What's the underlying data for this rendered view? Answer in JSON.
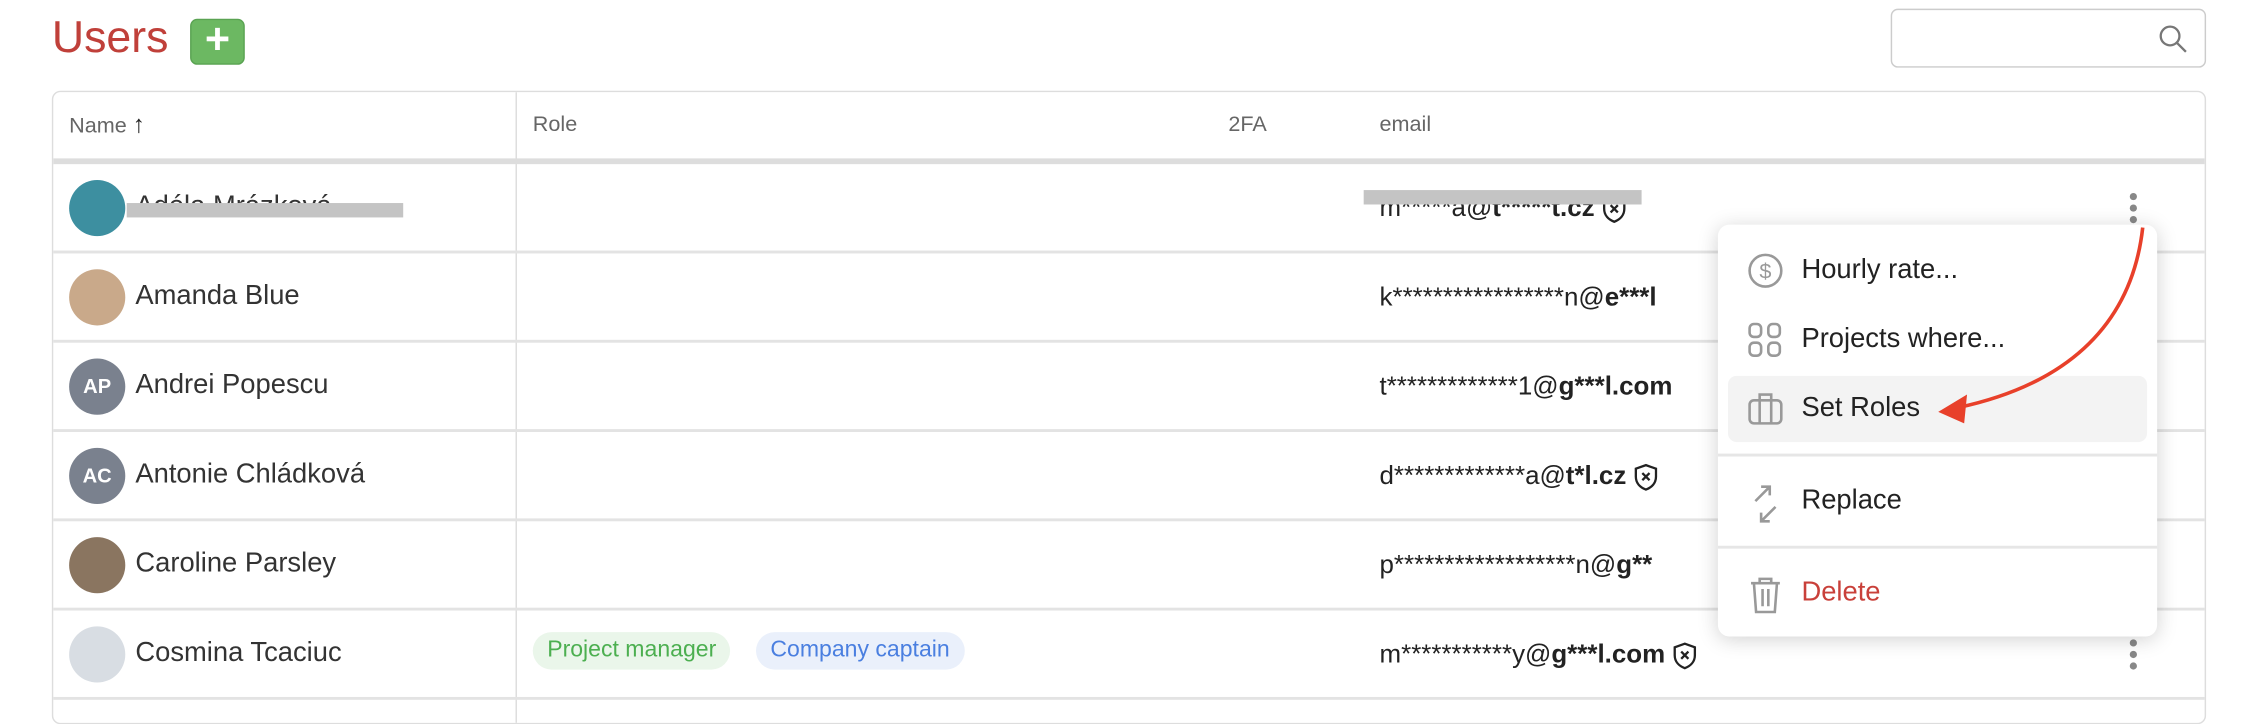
{
  "header": {
    "title": "Users",
    "add_label": "+",
    "search_placeholder": ""
  },
  "columns": {
    "name": "Name",
    "sort_indicator": "↑",
    "role": "Role",
    "twofa": "2FA",
    "email": "email"
  },
  "rows": [
    {
      "name": "Adéla Mrázková",
      "initials": "",
      "avatar_color": "#3d8fa0",
      "email_local": "m*****a@",
      "email_domain": "t*****t.cz",
      "shield": true,
      "roles": []
    },
    {
      "name": "Amanda Blue",
      "initials": "",
      "avatar_color": "#c9a98a",
      "email_local": "k*****************n@",
      "email_domain": "e***l",
      "shield": false,
      "roles": []
    },
    {
      "name": "Andrei Popescu",
      "initials": "AP",
      "avatar_color": "#7a818e",
      "email_local": "t*************1@",
      "email_domain": "g***l.com",
      "shield": false,
      "roles": []
    },
    {
      "name": "Antonie Chládková",
      "initials": "AC",
      "avatar_color": "#7a818e",
      "email_local": "d*************a@",
      "email_domain": "t*l.cz",
      "shield": true,
      "roles": []
    },
    {
      "name": "Caroline Parsley",
      "initials": "",
      "avatar_color": "#8a7560",
      "email_local": "p******************n@",
      "email_domain": "g**",
      "shield": false,
      "roles": []
    },
    {
      "name": "Cosmina Tcaciuc",
      "initials": "",
      "avatar_color": "#d8dde3",
      "email_local": "m***********y@",
      "email_domain": "g***l.com",
      "shield": true,
      "roles": [
        "Project manager",
        "Company captain"
      ]
    }
  ],
  "menu": {
    "items": [
      {
        "label": "Hourly rate...",
        "icon": "dollar-circle-icon"
      },
      {
        "label": "Projects where...",
        "icon": "grid-icon"
      },
      {
        "label": "Set Roles",
        "icon": "briefcase-icon",
        "highlighted": true
      },
      {
        "label": "Replace",
        "icon": "swap-arrows-icon"
      },
      {
        "label": "Delete",
        "icon": "trash-icon",
        "danger": true
      }
    ]
  },
  "colors": {
    "title": "#c0403a",
    "add_button": "#6cb862",
    "delete": "#c9403a",
    "annotation_arrow": "#e8402a",
    "tag_green_text": "#4caf50",
    "tag_blue_text": "#4a7fe0"
  }
}
